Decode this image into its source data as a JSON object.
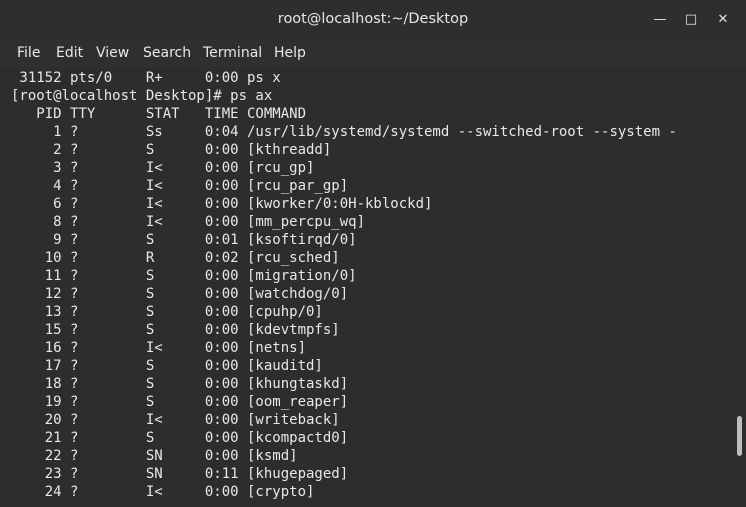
{
  "window": {
    "title": "root@localhost:~/Desktop",
    "minimize_glyph": "—",
    "maximize_glyph": "□",
    "close_glyph": "✕"
  },
  "menu": [
    "File",
    "Edit",
    "View",
    "Search",
    "Terminal",
    "Help"
  ],
  "terminal": {
    "lines": [
      " 31152 pts/0    R+     0:00 ps x",
      "[root@localhost Desktop]# ps ax",
      "   PID TTY      STAT   TIME COMMAND",
      "     1 ?        Ss     0:04 /usr/lib/systemd/systemd --switched-root --system -",
      "     2 ?        S      0:00 [kthreadd]",
      "     3 ?        I<     0:00 [rcu_gp]",
      "     4 ?        I<     0:00 [rcu_par_gp]",
      "     6 ?        I<     0:00 [kworker/0:0H-kblockd]",
      "     8 ?        I<     0:00 [mm_percpu_wq]",
      "     9 ?        S      0:01 [ksoftirqd/0]",
      "    10 ?        R      0:02 [rcu_sched]",
      "    11 ?        S      0:00 [migration/0]",
      "    12 ?        S      0:00 [watchdog/0]",
      "    13 ?        S      0:00 [cpuhp/0]",
      "    15 ?        S      0:00 [kdevtmpfs]",
      "    16 ?        I<     0:00 [netns]",
      "    17 ?        S      0:00 [kauditd]",
      "    18 ?        S      0:00 [khungtaskd]",
      "    19 ?        S      0:00 [oom_reaper]",
      "    20 ?        I<     0:00 [writeback]",
      "    21 ?        S      0:00 [kcompactd0]",
      "    22 ?        SN     0:00 [ksmd]",
      "    23 ?        SN     0:11 [khugepaged]",
      "    24 ?        I<     0:00 [crypto]"
    ]
  }
}
